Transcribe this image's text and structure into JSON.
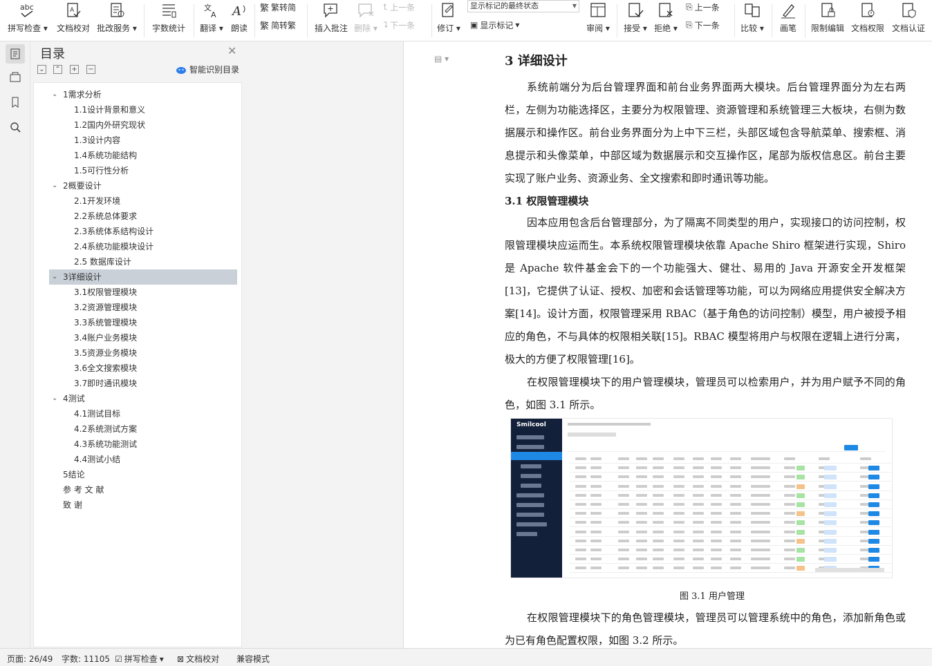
{
  "ribbon": {
    "buttons": [
      {
        "id": "spell-check",
        "label": "拼写检查",
        "icon": "abc-spell-icon",
        "dropdown": true
      },
      {
        "id": "doc-proof",
        "label": "文档校对",
        "icon": "doc-proof-icon"
      },
      {
        "id": "batch-service",
        "label": "批改服务",
        "icon": "batch-correct-icon",
        "dropdown": true
      },
      {
        "id": "word-count",
        "label": "字数统计",
        "icon": "word-count-icon"
      },
      {
        "id": "translate",
        "label": "翻译",
        "icon": "translate-icon",
        "dropdown": true
      },
      {
        "id": "read-aloud",
        "label": "朗读",
        "icon": "read-aloud-icon"
      },
      {
        "id": "insert-comment",
        "label": "插入批注",
        "icon": "insert-comment-icon"
      },
      {
        "id": "delete",
        "label": "删除",
        "icon": "delete-comment-icon",
        "dropdown": true,
        "disabled": true
      },
      {
        "id": "revise",
        "label": "修订",
        "icon": "revise-icon",
        "dropdown": true
      },
      {
        "id": "review",
        "label": "审阅",
        "icon": "review-icon",
        "dropdown": true
      },
      {
        "id": "accept",
        "label": "接受",
        "icon": "accept-icon",
        "dropdown": true
      },
      {
        "id": "reject",
        "label": "拒绝",
        "icon": "reject-icon",
        "dropdown": true
      },
      {
        "id": "compare",
        "label": "比较",
        "icon": "compare-icon",
        "dropdown": true
      },
      {
        "id": "pen",
        "label": "画笔",
        "icon": "pen-icon"
      },
      {
        "id": "restrict-edit",
        "label": "限制编辑",
        "icon": "restrict-edit-icon"
      },
      {
        "id": "doc-permission",
        "label": "文档权限",
        "icon": "doc-permission-icon"
      },
      {
        "id": "doc-cert",
        "label": "文档认证",
        "icon": "doc-cert-icon"
      }
    ],
    "small": {
      "trad": "繁转简",
      "simp": "简转繁",
      "prev_comment": "上一条",
      "next_comment": "下一条",
      "show_markup": "显示标记",
      "prev_change": "上一条",
      "next_change": "下一条"
    },
    "markup_state": "显示标记的最终状态"
  },
  "toc": {
    "title": "目录",
    "smart_label": "智能识别目录",
    "items": [
      {
        "text": "1需求分析",
        "level": 1,
        "expanded": true
      },
      {
        "text": "1.1设计背景和意义",
        "level": 2
      },
      {
        "text": "1.2国内外研究现状",
        "level": 2
      },
      {
        "text": "1.3设计内容",
        "level": 2
      },
      {
        "text": "1.4系统功能结构",
        "level": 2
      },
      {
        "text": "1.5可行性分析",
        "level": 2
      },
      {
        "text": "2概要设计",
        "level": 1,
        "expanded": true
      },
      {
        "text": "2.1开发环境",
        "level": 2
      },
      {
        "text": "2.2系统总体要求",
        "level": 2
      },
      {
        "text": "2.3系统体系结构设计",
        "level": 2
      },
      {
        "text": "2.4系统功能模块设计",
        "level": 2
      },
      {
        "text": "2.5  数据库设计",
        "level": 2
      },
      {
        "text": "3详细设计",
        "level": 1,
        "expanded": true,
        "selected": true
      },
      {
        "text": "3.1权限管理模块",
        "level": 2
      },
      {
        "text": "3.2资源管理模块",
        "level": 2
      },
      {
        "text": "3.3系统管理模块",
        "level": 2
      },
      {
        "text": "3.4账户业务模块",
        "level": 2
      },
      {
        "text": "3.5资源业务模块",
        "level": 2
      },
      {
        "text": "3.6全文搜索模块",
        "level": 2
      },
      {
        "text": "3.7即时通讯模块",
        "level": 2
      },
      {
        "text": "4测试",
        "level": 1,
        "expanded": true
      },
      {
        "text": "4.1测试目标",
        "level": 2
      },
      {
        "text": "4.2系统测试方案",
        "level": 2
      },
      {
        "text": "4.3系统功能测试",
        "level": 2
      },
      {
        "text": "4.4测试小结",
        "level": 2
      },
      {
        "text": "5结论",
        "level": 1
      },
      {
        "text": "参 考 文 献",
        "level": 1
      },
      {
        "text": "致  谢",
        "level": 1
      }
    ]
  },
  "document": {
    "heading1": "3    详细设计",
    "para1": "系统前端分为后台管理界面和前台业务界面两大模块。后台管理界面分为左右两栏，左侧为功能选择区，主要分为权限管理、资源管理和系统管理三大板块，右侧为数据展示和操作区。前台业务界面分为上中下三栏，头部区域包含导航菜单、搜索框、消息提示和头像菜单，中部区域为数据展示和交互操作区，尾部为版权信息区。前台主要实现了账户业务、资源业务、全文搜索和即时通讯等功能。",
    "heading2": "3.1    权限管理模块",
    "para2": "因本应用包含后台管理部分，为了隔离不同类型的用户，实现接口的访问控制，权限管理模块应运而生。本系统权限管理模块依靠 Apache Shiro 框架进行实现，Shiro 是 Apache 软件基金会下的一个功能强大、健壮、易用的 Java 开源安全开发框架[13]，它提供了认证、授权、加密和会话管理等功能，可以为网络应用提供安全解决方案[14]。设计方面，权限管理采用 RBAC（基于角色的访问控制）模型，用户被授予相应的角色，不与具体的权限相关联[15]。RBAC 模型将用户与权限在逻辑上进行分离，极大的方便了权限管理[16]。",
    "para3": "在权限管理模块下的用户管理模块，管理员可以检索用户，并为用户赋予不同的角色，如图 3.1 所示。",
    "figure_logo": "Smilcool",
    "caption": "图 3.1 用户管理",
    "para4": "在权限管理模块下的角色管理模块，管理员可以管理系统中的角色，添加新角色或为已有角色配置权限，如图 3.2 所示。"
  },
  "status": {
    "page": "页面: 26/49",
    "words": "字数: 11105",
    "spell": "拼写检查",
    "proof": "文档校对",
    "compat": "兼容模式"
  }
}
